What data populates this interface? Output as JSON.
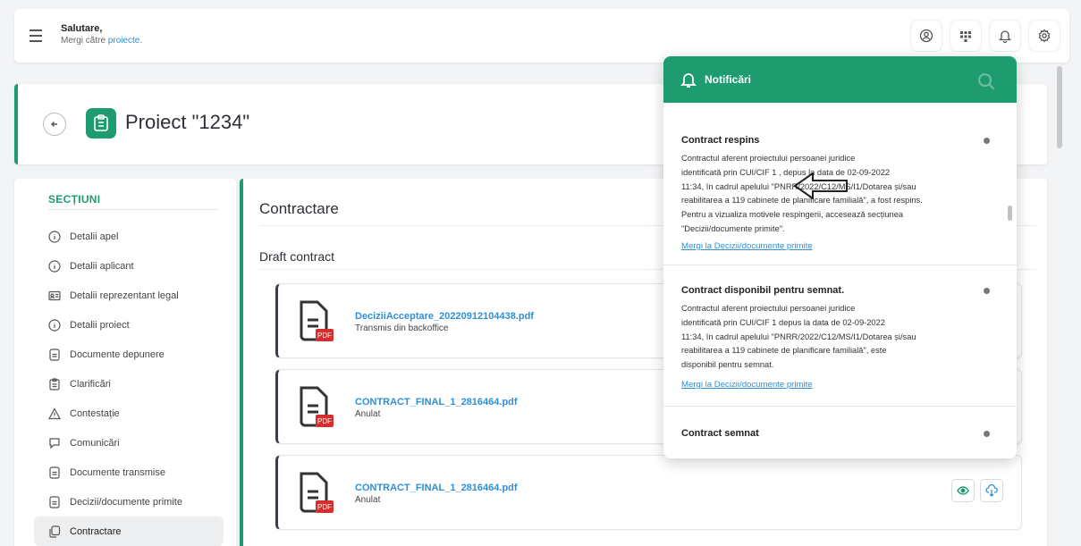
{
  "topbar": {
    "greeting_title": "Salutare,",
    "greeting_prefix": "Mergi către ",
    "greeting_link": "proiecte",
    "greeting_suffix": "."
  },
  "project": {
    "title": "Proiect \"1234\""
  },
  "sidebar": {
    "section_title": "SECȚIUNI",
    "items": [
      {
        "label": "Detalii apel",
        "icon": "info-icon"
      },
      {
        "label": "Detalii aplicant",
        "icon": "info-icon"
      },
      {
        "label": "Detalii reprezentant legal",
        "icon": "id-card-icon"
      },
      {
        "label": "Detalii proiect",
        "icon": "info-icon"
      },
      {
        "label": "Documente depunere",
        "icon": "document-icon"
      },
      {
        "label": "Clarificări",
        "icon": "clipboard-icon"
      },
      {
        "label": "Contestație",
        "icon": "warning-icon"
      },
      {
        "label": "Comunicări",
        "icon": "chat-icon"
      },
      {
        "label": "Documente transmise",
        "icon": "document-icon"
      },
      {
        "label": "Decizii/documente primite",
        "icon": "document-icon"
      },
      {
        "label": "Contractare",
        "icon": "copy-icon",
        "active": true
      }
    ]
  },
  "main": {
    "title": "Contractare",
    "subtitle": "Draft contract",
    "documents": [
      {
        "name": "DeciziiAcceptare_20220912104438.pdf",
        "status": "Transmis din backoffice",
        "badge": "PDF"
      },
      {
        "name": "CONTRACT_FINAL_1_2816464.pdf",
        "status": "Anulat",
        "badge": "PDF"
      },
      {
        "name": "CONTRACT_FINAL_1_2816464.pdf",
        "status": "Anulat",
        "badge": "PDF"
      }
    ]
  },
  "notifications": {
    "header": "Notificări",
    "items": [
      {
        "title": "Contract respins",
        "lines": [
          "Contractul aferent proiectului persoanei juridice",
          "identificată prin CUI/CIF 1          , depus la data de 02-09-2022",
          "11:34, în cadrul apelului \"PNRR/2022/C12/MS/I1/Dotarea și/sau",
          "reabilitarea a 119 cabinete de planificare familială\", a fost respins.",
          "Pentru a vizualiza motivele respingerii, accesează secțiunea",
          "\"Decizii/documente primite\"."
        ],
        "link": "Mergi la Decizii/documente primite"
      },
      {
        "title": "Contract disponibil pentru semnat.",
        "lines": [
          "Contractul aferent proiectului persoanei juridice",
          "identificată prin CUI/CIF 1           depus la data de 02-09-2022",
          "11:34, în cadrul apelului \"PNRR/2022/C12/MS/I1/Dotarea și/sau",
          "reabilitarea a 119 cabinete de planificare familială\", este",
          "disponibil pentru semnat."
        ],
        "link": "Mergi la Decizii/documente primite"
      },
      {
        "title": "Contract semnat",
        "lines": [],
        "link": ""
      }
    ]
  },
  "colors": {
    "accent": "#1e9b6f",
    "link": "#2f8fd6",
    "pdf_badge": "#d32f2f"
  }
}
